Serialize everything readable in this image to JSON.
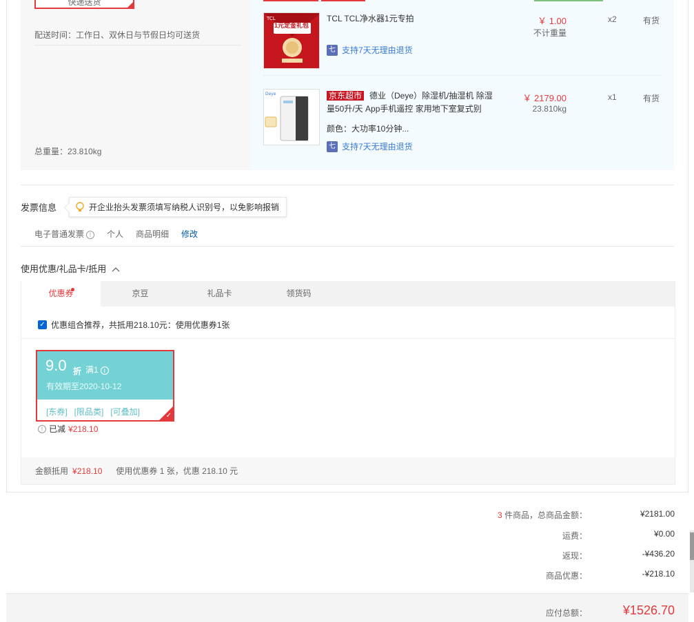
{
  "shipping": {
    "button_label": "快递送货",
    "time_text": "配送时间：工作日、双休日与节假日均可送货",
    "total_weight": "总重量：23.810kg"
  },
  "items": [
    {
      "name": "TCL TCL净水器1元专拍",
      "price": "￥ 1.00",
      "weight": "不计重量",
      "qty": "x2",
      "stock": "有货",
      "return": "支持7天无理由退货",
      "thumb_text": "1元定金礼包"
    },
    {
      "tag": "京东超市",
      "name": "德业（Deye）除湿机/抽湿机 除湿量50升/天 App手机遥控 家用地下室复式别",
      "attr": "颜色：大功率10分钟...",
      "price": "￥ 2179.00",
      "weight": "23.810kg",
      "qty": "x1",
      "stock": "有货",
      "return": "支持7天无理由退货"
    }
  ],
  "invoice": {
    "title": "发票信息",
    "tip": "开企业抬头发票须填写纳税人识别号，以免影响报销",
    "type": "电子普通发票",
    "holder": "个人",
    "content": "商品明细",
    "edit": "修改"
  },
  "coupons": {
    "title": "使用优惠/礼品卡/抵用",
    "tabs": [
      "优惠券",
      "京豆",
      "礼品卡",
      "领货码"
    ],
    "combo_text": "优惠组合推荐，共抵用218.10元：使用优惠券1张",
    "card": {
      "value": "9.0",
      "unit": "折",
      "condition": "满1",
      "expire": "有效期至2020-10-12",
      "tags": [
        "[东券]",
        "[限品类]",
        "[可叠加]"
      ]
    },
    "saved_label": "已减",
    "saved_amount": "¥218.10",
    "summary_label": "金额抵用",
    "summary_amount": "¥218.10",
    "summary_text": "使用优惠券 1 张，优惠 218.10 元"
  },
  "totals": {
    "count": "3",
    "count_label": "件商品，总商品金额：",
    "goods_amount": "¥2181.00",
    "freight_label": "运费：",
    "freight": "¥0.00",
    "rebate_label": "返现：",
    "rebate": "-¥436.20",
    "discount_label": "商品优惠：",
    "discount": "-¥218.10",
    "pay_label": "应付总额：",
    "pay_amount": "¥1526.70"
  }
}
